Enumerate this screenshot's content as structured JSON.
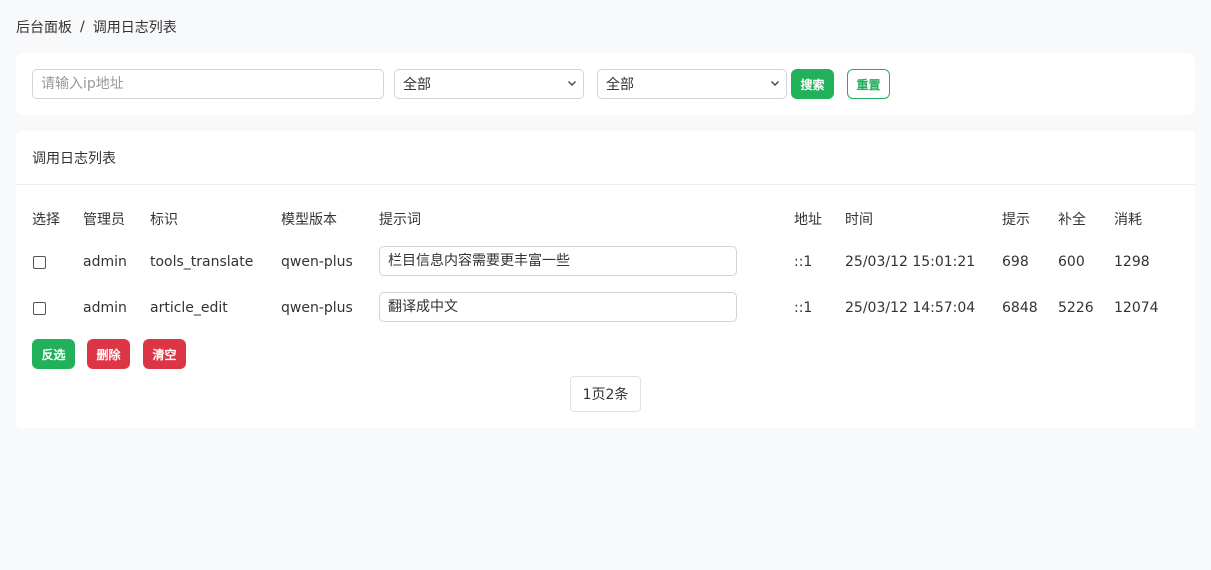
{
  "breadcrumb": {
    "root": "后台面板",
    "separator": "/",
    "current": "调用日志列表"
  },
  "filter": {
    "ip_placeholder": "请输入ip地址",
    "ip_value": "",
    "select1_value": "全部",
    "select2_value": "全部",
    "search_label": "搜索",
    "reset_label": "重置"
  },
  "list": {
    "title": "调用日志列表",
    "columns": {
      "select": "选择",
      "admin": "管理员",
      "tag": "标识",
      "model": "模型版本",
      "prompt": "提示词",
      "address": "地址",
      "time": "时间",
      "prompt_tokens": "提示",
      "completion_tokens": "补全",
      "total_tokens": "消耗"
    },
    "rows": [
      {
        "admin": "admin",
        "tag": "tools_translate",
        "model": "qwen-plus",
        "prompt": "栏目信息内容需要更丰富一些",
        "address": "::1",
        "time": "25/03/12 15:01:21",
        "prompt_tokens": "698",
        "completion_tokens": "600",
        "total_tokens": "1298"
      },
      {
        "admin": "admin",
        "tag": "article_edit",
        "model": "qwen-plus",
        "prompt": "翻译成中文",
        "address": "::1",
        "time": "25/03/12 14:57:04",
        "prompt_tokens": "6848",
        "completion_tokens": "5226",
        "total_tokens": "12074"
      }
    ],
    "actions": {
      "invert_label": "反选",
      "delete_label": "删除",
      "clear_label": "清空"
    },
    "pagination": "1页2条"
  },
  "colors": {
    "primary_green": "#20b15a",
    "danger_red": "#dc3545",
    "page_bg": "#f8f9fb"
  }
}
